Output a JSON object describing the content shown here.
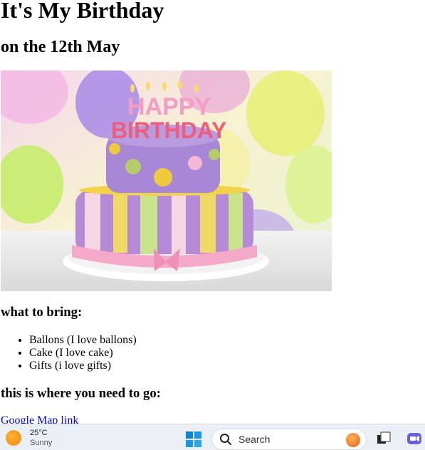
{
  "page": {
    "title": "It's My Birthday",
    "subtitle": "on the 12th May",
    "bring_heading": "what to bring:",
    "bring_items": [
      "Ballons (I love ballons)",
      "Cake (I love cake)",
      "Gifts (i love gifts)"
    ],
    "go_heading": "this is where you need to go:",
    "map_link": "Google Map link",
    "hero_image": {
      "top_text": "HAPPY",
      "bottom_text": "BIRTHDAY"
    }
  },
  "taskbar": {
    "weather": {
      "temp": "25°C",
      "condition": "Sunny",
      "icon": "sun-icon"
    },
    "start_icon": "windows-logo-icon",
    "search_placeholder": "Search",
    "apps": [
      "file-explorer-icon",
      "task-view-icon",
      "teams-icon"
    ]
  }
}
